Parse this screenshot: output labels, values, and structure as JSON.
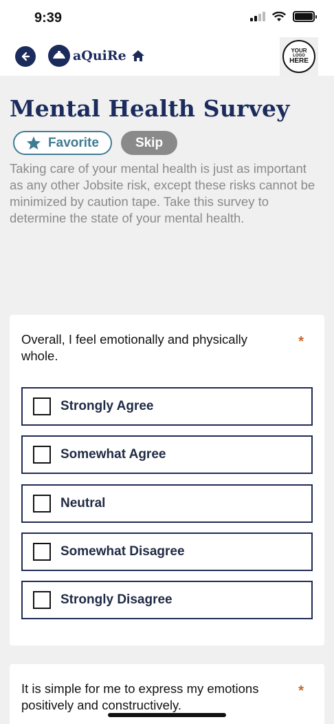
{
  "status": {
    "time": "9:39"
  },
  "header": {
    "brand": "aQuiRe",
    "logo_lines": [
      "YOUR",
      "LOGO",
      "HERE"
    ]
  },
  "page": {
    "title": "Mental Health Survey",
    "favorite_label": "Favorite",
    "skip_label": "Skip",
    "intro": "Taking care of your mental health is just as important as any other Jobsite risk, except these risks cannot be minimized by caution tape. Take this survey to determine the state of your mental health."
  },
  "questions": [
    {
      "text": "Overall, I feel emotionally and physically whole.",
      "required_mark": "*",
      "options": [
        "Strongly Agree",
        "Somewhat Agree",
        "Neutral",
        "Somewhat Disagree",
        "Strongly Disagree"
      ]
    },
    {
      "text": "It is simple for me to express my emotions positively and constructively.",
      "required_mark": "*"
    }
  ],
  "colors": {
    "brand": "#1a2b5c",
    "accent": "#3f7b93",
    "required": "#c8642c",
    "muted": "#8a8a8a"
  },
  "icons": {
    "back": "back-arrow-icon",
    "home": "home-icon",
    "favorite": "star-icon"
  }
}
